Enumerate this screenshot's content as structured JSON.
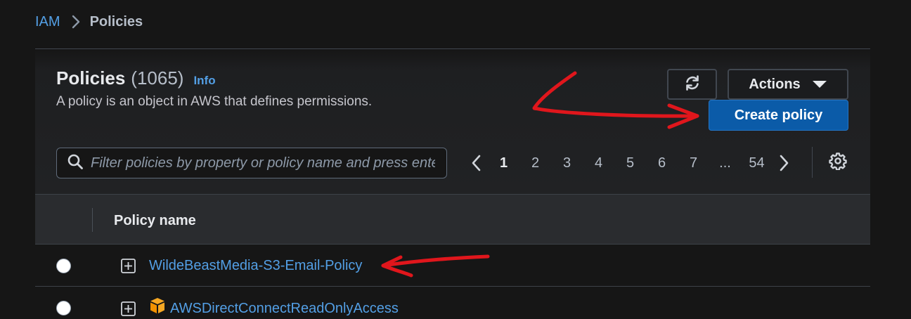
{
  "breadcrumb": {
    "root": "IAM",
    "current": "Policies"
  },
  "header": {
    "title": "Policies",
    "count": "(1065)",
    "info": "Info",
    "description": "A policy is an object in AWS that defines permissions."
  },
  "toolbar": {
    "refresh_icon": "refresh-icon",
    "actions_label": "Actions",
    "create_label": "Create policy"
  },
  "search": {
    "placeholder": "Filter policies by property or policy name and press enter"
  },
  "pagination": {
    "pages": [
      "1",
      "2",
      "3",
      "4",
      "5",
      "6",
      "7",
      "...",
      "54"
    ],
    "current": "1"
  },
  "table": {
    "column": "Policy name",
    "rows": [
      {
        "name": "WildeBeastMedia-S3-Email-Policy",
        "aws_managed": false
      },
      {
        "name": "AWSDirectConnectReadOnlyAccess",
        "aws_managed": true
      }
    ]
  },
  "colors": {
    "background": "#161616",
    "link": "#539fe5",
    "primary_button": "#0b5ba8",
    "annotation": "#e0161c"
  }
}
